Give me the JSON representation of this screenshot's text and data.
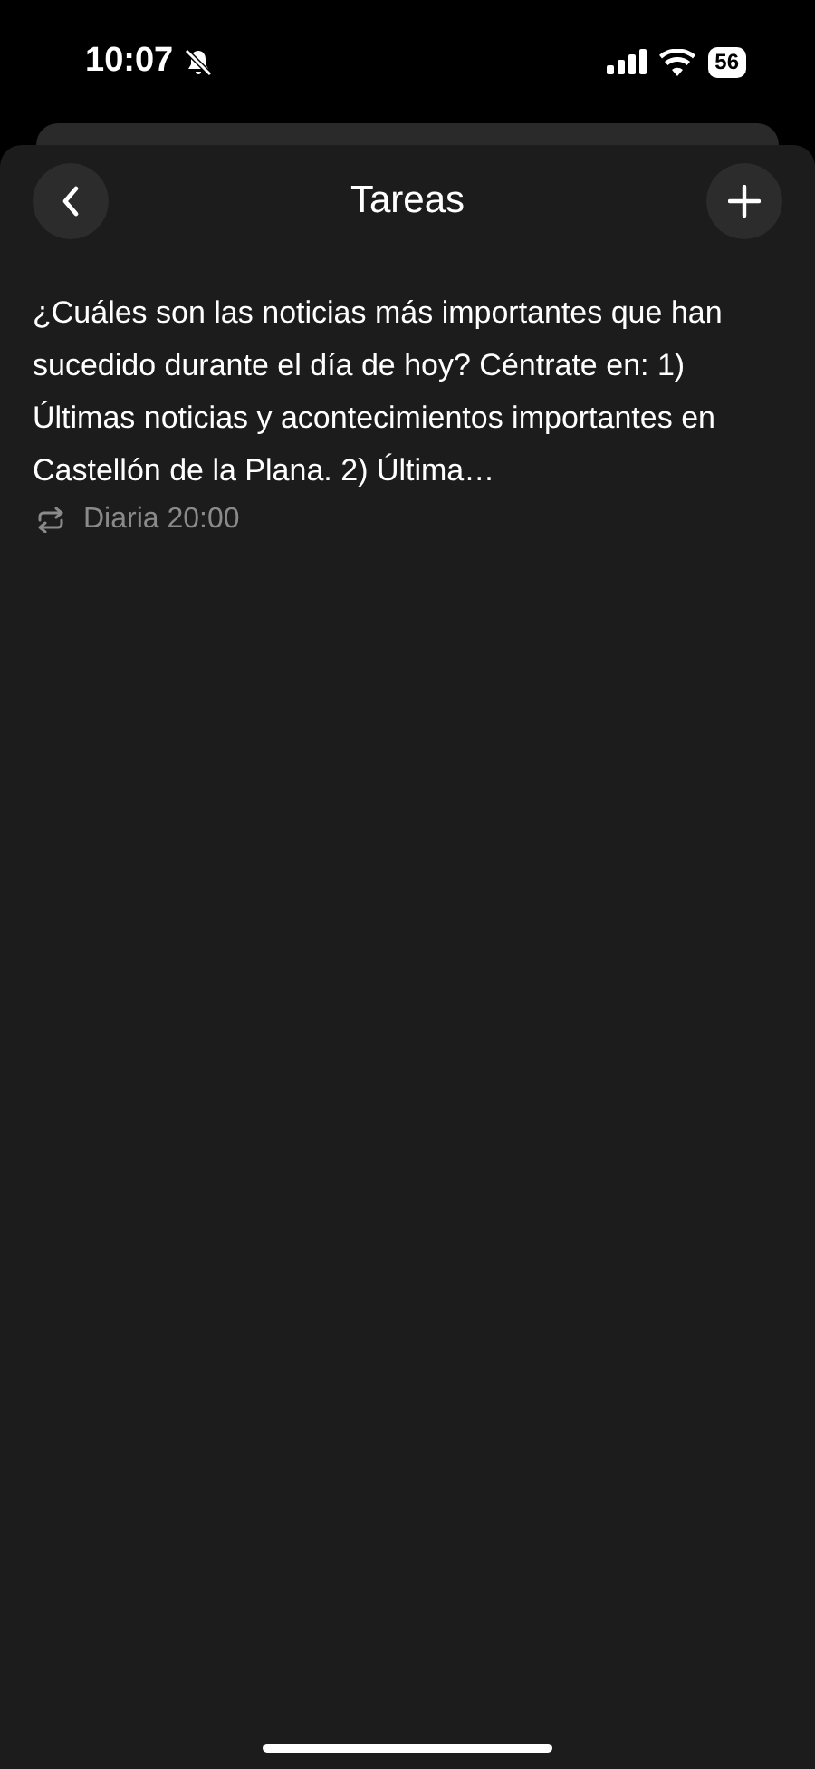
{
  "status_bar": {
    "time": "10:07",
    "silent": true,
    "battery": "56"
  },
  "header": {
    "title": "Tareas"
  },
  "tasks": [
    {
      "text": "¿Cuáles son las noticias más importantes que han sucedido durante el día de hoy? Céntrate en: 1) Últimas noticias y acontecimientos importantes en Castellón de la Plana. 2) Última…",
      "schedule": "Diaria 20:00"
    }
  ]
}
